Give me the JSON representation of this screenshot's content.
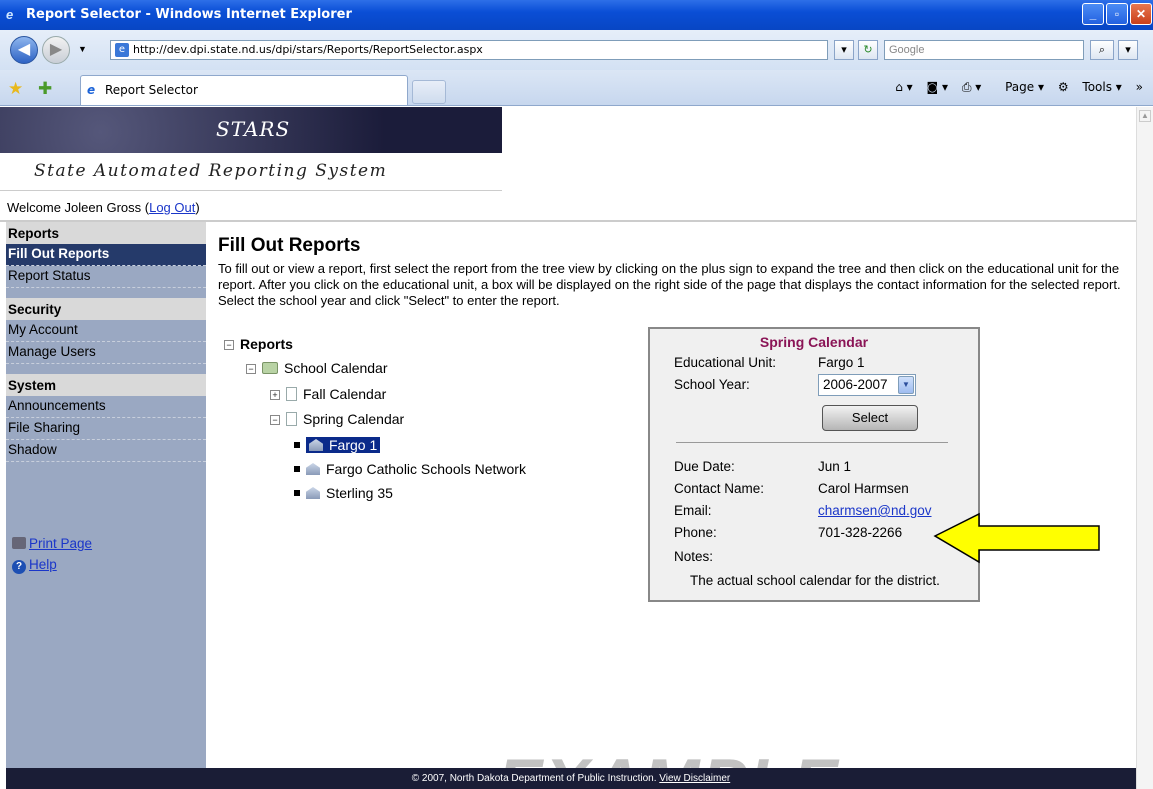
{
  "window": {
    "title": "Report Selector - Windows Internet Explorer"
  },
  "address": {
    "url": "http://dev.dpi.state.nd.us/dpi/stars/Reports/ReportSelector.aspx",
    "search_placeholder": "Google"
  },
  "tab": {
    "label": "Report Selector"
  },
  "commandbar": {
    "page": "Page",
    "tools": "Tools"
  },
  "banner": {
    "title": "STARS",
    "subtitle": "State Automated Reporting System"
  },
  "welcome": {
    "text": "Welcome Joleen Gross (",
    "logout": "Log Out",
    "close": ")"
  },
  "sidebar": {
    "reports_header": "Reports",
    "reports": [
      "Fill Out Reports",
      "Report Status"
    ],
    "security_header": "Security",
    "security": [
      "My Account",
      "Manage Users"
    ],
    "system_header": "System",
    "system": [
      "Announcements",
      "File Sharing",
      "Shadow"
    ],
    "print": "Print Page",
    "help": "Help"
  },
  "main": {
    "title": "Fill Out Reports",
    "instructions": "To fill out or view a report, first select the report from the tree view by clicking on the plus sign to expand the tree and then click on the educational unit for the report. After you click on the educational unit, a box will be displayed on the right side of the page that displays the contact information for the selected report. Select the school year and click \"Select\" to enter the report."
  },
  "tree": {
    "root": "Reports",
    "category": "School Calendar",
    "fall": "Fall Calendar",
    "spring": "Spring Calendar",
    "units": [
      "Fargo 1",
      "Fargo Catholic Schools Network",
      "Sterling 35"
    ]
  },
  "details": {
    "title": "Spring Calendar",
    "unit_label": "Educational Unit:",
    "unit_value": "Fargo 1",
    "year_label": "School Year:",
    "year_value": "2006-2007",
    "select_button": "Select",
    "due_label": "Due Date:",
    "due_value": "Jun 1",
    "contact_label": "Contact Name:",
    "contact_value": "Carol Harmsen",
    "email_label": "Email:",
    "email_value": "charmsen@nd.gov",
    "phone_label": "Phone:",
    "phone_value": "701-328-2266",
    "notes_label": "Notes:",
    "notes_value": "The actual school calendar for the district."
  },
  "watermark": "EXAMPLE",
  "footer": {
    "text": "© 2007, North Dakota Department of Public Instruction. ",
    "disclaimer": "View Disclaimer"
  }
}
